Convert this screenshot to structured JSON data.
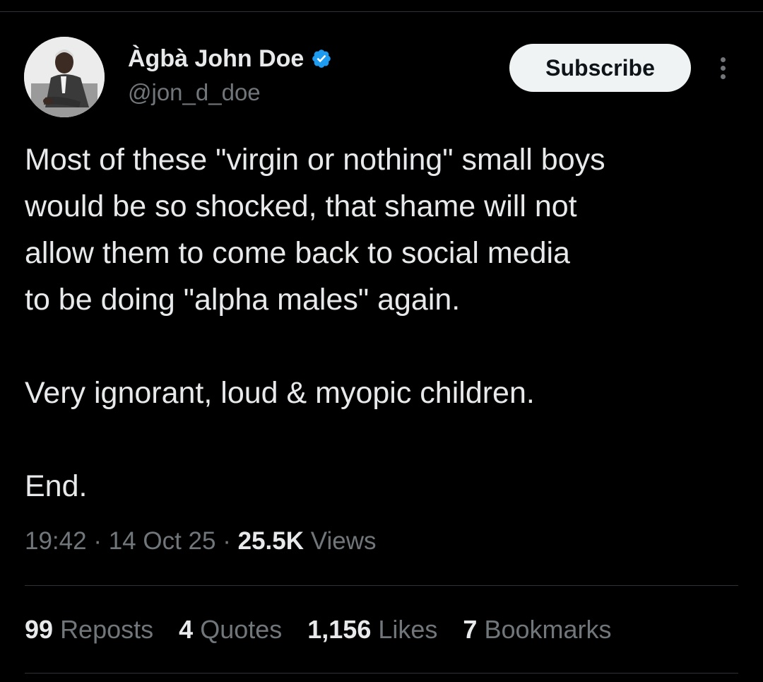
{
  "author": {
    "display_name": "Àgbà John Doe",
    "handle": "@jon_d_doe",
    "verified_icon": "verified-badge-icon",
    "avatar_icon": "profile-photo"
  },
  "actions": {
    "subscribe_label": "Subscribe",
    "more_icon": "more-options-icon"
  },
  "tweet": {
    "lines": [
      "Most of these \"virgin or nothing\" small boys",
      "would be so shocked, that shame will not",
      "allow them to come back to social media",
      "to be doing \"alpha males\" again."
    ],
    "paragraph2": "Very ignorant, loud & myopic children.",
    "paragraph3": "End."
  },
  "meta": {
    "time": "19:42",
    "separator": "·",
    "date": "14 Oct 25",
    "views_count": "25.5K",
    "views_label": "Views"
  },
  "stats": [
    {
      "count": "99",
      "label": "Reposts"
    },
    {
      "count": "4",
      "label": "Quotes"
    },
    {
      "count": "1,156",
      "label": "Likes"
    },
    {
      "count": "7",
      "label": "Bookmarks"
    }
  ],
  "colors": {
    "background": "#000000",
    "text_primary": "#e7e9ea",
    "text_secondary": "#71767b",
    "verified_blue": "#1d9bf0",
    "button_bg": "#eff3f4",
    "divider": "#2f3336"
  }
}
